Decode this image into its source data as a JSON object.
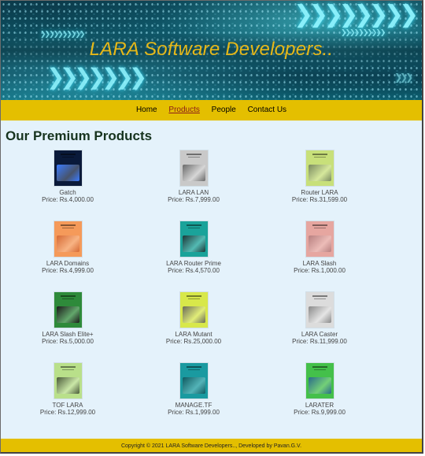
{
  "header": {
    "title": "LARA Software Developers.."
  },
  "nav": {
    "items": [
      {
        "label": "Home"
      },
      {
        "label": "Products"
      },
      {
        "label": "People"
      },
      {
        "label": "Contact Us"
      }
    ],
    "active": "Products"
  },
  "main": {
    "heading": "Our Premium Products",
    "products": [
      {
        "name": "Gatch",
        "price": "Price: Rs.4,000.00",
        "thumb_bg": "#0a1a3a",
        "thumb_accent": "#3a7bff"
      },
      {
        "name": "LARA LAN",
        "price": "Price: Rs.7,999.00",
        "thumb_bg": "#c9c9c9",
        "thumb_accent": "#6a6a6a"
      },
      {
        "name": "Router LARA",
        "price": "Price: Rs.31,599.00",
        "thumb_bg": "#c8e07a",
        "thumb_accent": "#7a8a60"
      },
      {
        "name": "LARA Domains",
        "price": "Price: Rs.4,999.00",
        "thumb_bg": "#f59a5a",
        "thumb_accent": "#d66a34"
      },
      {
        "name": "LARA Router Prime",
        "price": "Price: Rs.4,570.00",
        "thumb_bg": "#1aa39a",
        "thumb_accent": "#1c3838"
      },
      {
        "name": "LARA Slash",
        "price": "Price: Rs.1,000.00",
        "thumb_bg": "#e6a6a0",
        "thumb_accent": "#b88080"
      },
      {
        "name": "LARA Slash Elite+",
        "price": "Price: Rs.5,000.00",
        "thumb_bg": "#2e8a3a",
        "thumb_accent": "#1a1a1a"
      },
      {
        "name": "LARA Mutant",
        "price": "Price: Rs.25,000.00",
        "thumb_bg": "#d8e84a",
        "thumb_accent": "#6a6a5a"
      },
      {
        "name": "LARA Caster",
        "price": "Price: Rs.11,999.00",
        "thumb_bg": "#dcdcdc",
        "thumb_accent": "#8a8a8a"
      },
      {
        "name": "TOF LARA",
        "price": "Price: Rs.12,999.00",
        "thumb_bg": "#b9e08a",
        "thumb_accent": "#4a5a3a"
      },
      {
        "name": "MANAGE.TF",
        "price": "Price: Rs.1,999.00",
        "thumb_bg": "#1a9aa0",
        "thumb_accent": "#0f5a60"
      },
      {
        "name": "LARATER",
        "price": "Price: Rs.9,999.00",
        "thumb_bg": "#44c04a",
        "thumb_accent": "#2a6a8a"
      }
    ]
  },
  "footer": {
    "text": "Copyright © 2021 LARA Software Developers.., Developed by Pavan.G.V."
  },
  "colors": {
    "nav_bg": "#e4bf00",
    "title": "#e6b818",
    "heading": "#16331e",
    "page_bg": "#e4f2fb"
  }
}
